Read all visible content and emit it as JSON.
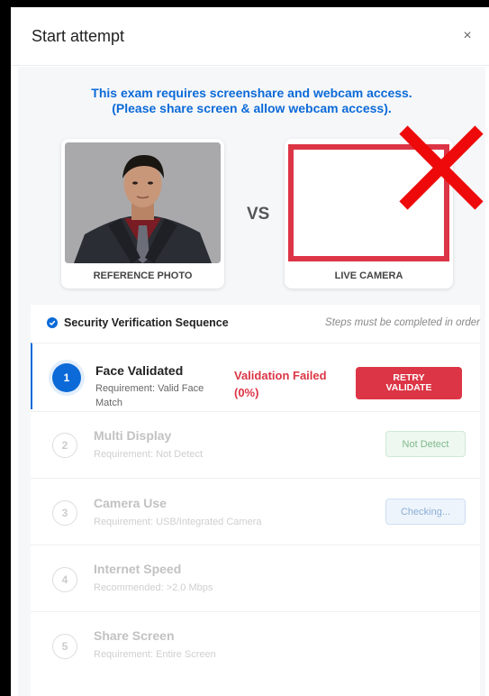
{
  "modal": {
    "title": "Start attempt",
    "close_label": "×"
  },
  "notice": {
    "line1": "This exam requires screenshare and webcam access.",
    "line2": "(Please share screen & allow webcam access)."
  },
  "comparison": {
    "reference_label": "REFERENCE PHOTO",
    "vs_label": "VS",
    "live_label": "LIVE CAMERA"
  },
  "sequence": {
    "title": "Security Verification Sequence",
    "note": "Steps must be completed in order",
    "steps": [
      {
        "number": "1",
        "title": "Face Validated",
        "requirement_line1": "Requirement: Valid Face",
        "requirement_line2": "Match",
        "status_line1": "Validation Failed",
        "status_line2": "(0%)",
        "action_line1": "RETRY",
        "action_line2": "VALIDATE"
      },
      {
        "number": "2",
        "title": "Multi Display",
        "requirement": "Requirement: Not Detect",
        "badge": "Not Detect"
      },
      {
        "number": "3",
        "title": "Camera Use",
        "requirement": "Requirement: USB/Integrated Camera",
        "badge": "Checking..."
      },
      {
        "number": "4",
        "title": "Internet Speed",
        "requirement": "Recommended: >2.0 Mbps"
      },
      {
        "number": "5",
        "title": "Share Screen",
        "requirement": "Requirement: Entire Screen"
      }
    ]
  },
  "colors": {
    "accent": "#0b6ad8",
    "danger": "#dc3545"
  },
  "icons": [
    "close-icon",
    "check-circle-icon",
    "red-x-icon"
  ]
}
